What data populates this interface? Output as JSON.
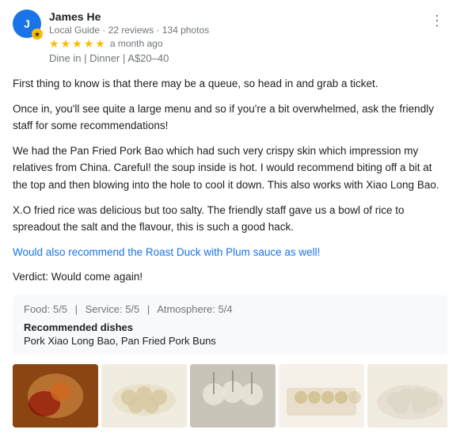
{
  "reviewer": {
    "name": "James He",
    "initials": "J",
    "meta": "Local Guide · 22 reviews · 134 photos",
    "time": "a month ago",
    "dine_type": "Dine in",
    "meal": "Dinner",
    "price": "A$20–40"
  },
  "stars": {
    "count": 5,
    "filled": "★★★★★"
  },
  "review": {
    "p1": "First thing to know is that there may be a queue, so head in and grab a ticket.",
    "p2": "Once in, you'll see quite a large menu and so if you're a bit overwhelmed, ask the friendly staff for some recommendations!",
    "p3": "We had the Pan Fried Pork Bao which had such very crispy skin which impression my relatives from China. Careful! the soup inside is hot. I would recommend biting off a bit at the top and then blowing into the hole to cool it down. This also works with Xiao Long Bao.",
    "p4": "X.O fried rice was delicious but too salty. The friendly staff gave us a bowl of rice to spreadout the salt and the flavour, this is such a good hack.",
    "p5": "Would also recommend the Roast Duck with Plum sauce as well!",
    "p6": "Verdict: Would come again!"
  },
  "ratings": {
    "food_label": "Food:",
    "food_score": "5/5",
    "service_label": "Service:",
    "service_score": "5/5",
    "atmosphere_label": "Atmosphere:",
    "atmosphere_score": "5/4"
  },
  "recommended": {
    "label": "Recommended dishes",
    "items": "Pork Xiao Long Bao, Pan Fried Pork Buns"
  },
  "more_icon": "⋮"
}
